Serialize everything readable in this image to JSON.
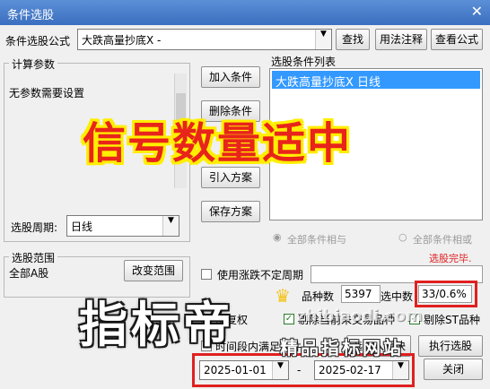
{
  "window": {
    "title": "条件选股",
    "close_glyph": "✕"
  },
  "formula": {
    "label": "条件选股公式",
    "value": "大跌高量抄底X  -",
    "buttons": [
      "查找",
      "用法注释",
      "查看公式"
    ]
  },
  "params": {
    "group_label": "计算参数",
    "text": "无参数需要设置"
  },
  "period": {
    "label": "选股周期:",
    "value": "日线"
  },
  "middle_buttons": [
    "加入条件",
    "删除条件",
    "引入方案",
    "保存方案"
  ],
  "cond_list": {
    "label": "选股条件列表",
    "items": [
      "大跌高量抄底X  日线"
    ]
  },
  "logic": {
    "and_label": "全部条件相与",
    "or_label": "全部条件相或"
  },
  "status": {
    "text": "选股完毕."
  },
  "range": {
    "group_label": "选股范围",
    "value": "全部A股",
    "change_button": "改变范围"
  },
  "period_check": {
    "label": "使用涨跌不定周期"
  },
  "stats": {
    "count_label": "品种数",
    "count_value": "5397",
    "hit_label": "选中数",
    "hit_value": "33/0.6%"
  },
  "options": {
    "rights_label": "前复权",
    "exclude_label": "剔除当前未交易品种",
    "exclude_st_label": "剔除ST品种"
  },
  "time_row": {
    "label": "时间段内满足条件",
    "to_board_button": "选股入板块",
    "run_button": "执行选股"
  },
  "dates": {
    "start": "2025-01-01",
    "sep": "-",
    "end": "2025-02-17",
    "close_button": "关闭"
  },
  "overlay": {
    "title": "信号数量适中",
    "watermark_big": "指标帝",
    "watermark_small": "精品指标网站",
    "watermark_url": "zhibiaodi.com"
  },
  "colors": {
    "titlebar": "#3b6fc0",
    "selection": "#3399ff",
    "red": "#e02020",
    "accent_yellow": "#ffee00"
  }
}
